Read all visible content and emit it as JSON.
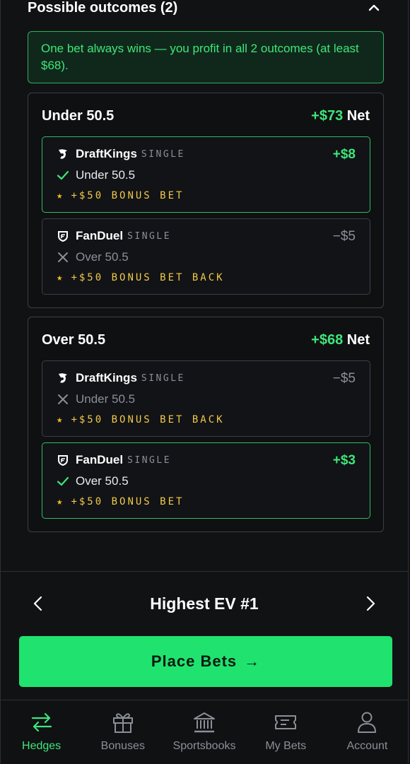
{
  "section": {
    "title": "Possible outcomes (2)"
  },
  "summary": {
    "text": "One bet always wins — you profit in all 2 outcomes (at least $68)."
  },
  "outcomes": [
    {
      "name": "Under 50.5",
      "net_amount": "+$73",
      "net_label": "Net",
      "bets": [
        {
          "book": "DraftKings",
          "type": "SINGLE",
          "selection": "Under 50.5",
          "amount": "+$8",
          "bonus": "+$50 BONUS BET",
          "result": "win"
        },
        {
          "book": "FanDuel",
          "type": "SINGLE",
          "selection": "Over 50.5",
          "amount": "−$5",
          "bonus": "+$50 BONUS BET BACK",
          "result": "loss"
        }
      ]
    },
    {
      "name": "Over 50.5",
      "net_amount": "+$68",
      "net_label": "Net",
      "bets": [
        {
          "book": "DraftKings",
          "type": "SINGLE",
          "selection": "Under 50.5",
          "amount": "−$5",
          "bonus": "+$50 BONUS BET BACK",
          "result": "loss"
        },
        {
          "book": "FanDuel",
          "type": "SINGLE",
          "selection": "Over 50.5",
          "amount": "+$3",
          "bonus": "+$50 BONUS BET",
          "result": "win"
        }
      ]
    }
  ],
  "navigator": {
    "title": "Highest EV #1"
  },
  "cta": {
    "label": "Place Bets",
    "arrow": "→"
  },
  "tabs": [
    {
      "label": "Hedges",
      "icon": "arrows-swap-icon",
      "active": true
    },
    {
      "label": "Bonuses",
      "icon": "gift-icon",
      "active": false
    },
    {
      "label": "Sportsbooks",
      "icon": "bank-icon",
      "active": false
    },
    {
      "label": "My Bets",
      "icon": "ticket-icon",
      "active": false
    },
    {
      "label": "Account",
      "icon": "user-icon",
      "active": false
    }
  ],
  "colors": {
    "accent": "#3ee57a",
    "button": "#20e36f",
    "bonus": "#f2c84b",
    "muted": "#8a8f98"
  }
}
